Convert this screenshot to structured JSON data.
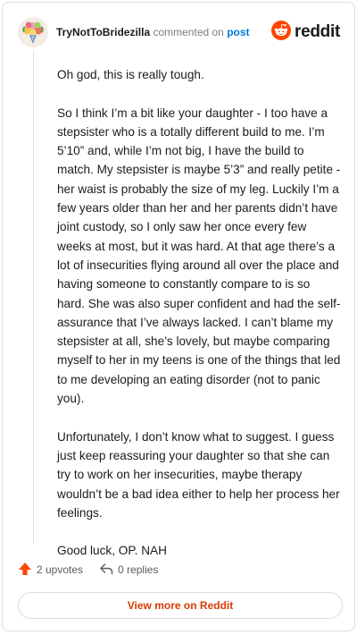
{
  "header": {
    "username": "TryNotToBridezilla",
    "action_text": "commented on",
    "post_link": "post",
    "brand_name": "reddit",
    "brand_color": "#ff4500",
    "avatar_icon": "bouquet-avatar-icon"
  },
  "comment": {
    "paragraphs": [
      "Oh god, this is really tough.",
      "So I think I’m a bit like your daughter - I too have a stepsister who is a totally different build to me. I’m 5’10” and, while I’m not big, I have the build to match. My stepsister is maybe 5’3” and really petite - her waist is probably the size of my leg. Luckily I’m a few years older than her and her parents didn’t have joint custody, so I only saw her once every few weeks at most, but it was hard. At that age there’s a lot of insecurities flying around all over the place and having someone to constantly compare to is so hard. She was also super confident and had the self-assurance that I’ve always lacked. I can’t blame my stepsister at all, she’s lovely, but maybe comparing myself to her in my teens is one of the things that led to me developing an eating disorder (not to panic you).",
      "Unfortunately, I don’t know what to suggest. I guess just keep reassuring your daughter so that she can try to work on her insecurities, maybe therapy wouldn’t be a bad idea either to help her process her feelings.",
      "Good luck, OP. NAH"
    ]
  },
  "actions": {
    "upvotes_label": "2 upvotes",
    "replies_label": "0 replies",
    "upvote_icon": "upvote-arrow-icon",
    "reply_icon": "reply-arrow-icon",
    "upvote_color": "#ff4500"
  },
  "footer": {
    "view_more_label": "View more on Reddit",
    "view_more_color": "#d93a00"
  }
}
